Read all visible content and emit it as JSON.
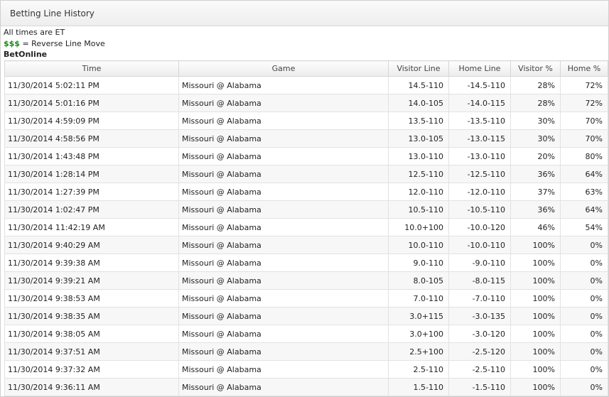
{
  "window": {
    "title": "Betting Line History"
  },
  "notes": {
    "times": "All times are ET",
    "money_symbol": "$$$",
    "money_desc": " = Reverse Line Move"
  },
  "book": "BetOnline",
  "columns": [
    "Time",
    "Game",
    "Visitor Line",
    "Home Line",
    "Visitor %",
    "Home %"
  ],
  "rows": [
    [
      "11/30/2014 5:02:11 PM",
      "Missouri @ Alabama",
      "14.5-110",
      "-14.5-110",
      "28%",
      "72%"
    ],
    [
      "11/30/2014 5:01:16 PM",
      "Missouri @ Alabama",
      "14.0-105",
      "-14.0-115",
      "28%",
      "72%"
    ],
    [
      "11/30/2014 4:59:09 PM",
      "Missouri @ Alabama",
      "13.5-110",
      "-13.5-110",
      "30%",
      "70%"
    ],
    [
      "11/30/2014 4:58:56 PM",
      "Missouri @ Alabama",
      "13.0-105",
      "-13.0-115",
      "30%",
      "70%"
    ],
    [
      "11/30/2014 1:43:48 PM",
      "Missouri @ Alabama",
      "13.0-110",
      "-13.0-110",
      "20%",
      "80%"
    ],
    [
      "11/30/2014 1:28:14 PM",
      "Missouri @ Alabama",
      "12.5-110",
      "-12.5-110",
      "36%",
      "64%"
    ],
    [
      "11/30/2014 1:27:39 PM",
      "Missouri @ Alabama",
      "12.0-110",
      "-12.0-110",
      "37%",
      "63%"
    ],
    [
      "11/30/2014 1:02:47 PM",
      "Missouri @ Alabama",
      "10.5-110",
      "-10.5-110",
      "36%",
      "64%"
    ],
    [
      "11/30/2014 11:42:19 AM",
      "Missouri @ Alabama",
      "10.0+100",
      "-10.0-120",
      "46%",
      "54%"
    ],
    [
      "11/30/2014 9:40:29 AM",
      "Missouri @ Alabama",
      "10.0-110",
      "-10.0-110",
      "100%",
      "0%"
    ],
    [
      "11/30/2014 9:39:38 AM",
      "Missouri @ Alabama",
      "9.0-110",
      "-9.0-110",
      "100%",
      "0%"
    ],
    [
      "11/30/2014 9:39:21 AM",
      "Missouri @ Alabama",
      "8.0-105",
      "-8.0-115",
      "100%",
      "0%"
    ],
    [
      "11/30/2014 9:38:53 AM",
      "Missouri @ Alabama",
      "7.0-110",
      "-7.0-110",
      "100%",
      "0%"
    ],
    [
      "11/30/2014 9:38:35 AM",
      "Missouri @ Alabama",
      "3.0+115",
      "-3.0-135",
      "100%",
      "0%"
    ],
    [
      "11/30/2014 9:38:05 AM",
      "Missouri @ Alabama",
      "3.0+100",
      "-3.0-120",
      "100%",
      "0%"
    ],
    [
      "11/30/2014 9:37:51 AM",
      "Missouri @ Alabama",
      "2.5+100",
      "-2.5-120",
      "100%",
      "0%"
    ],
    [
      "11/30/2014 9:37:32 AM",
      "Missouri @ Alabama",
      "2.5-110",
      "-2.5-110",
      "100%",
      "0%"
    ],
    [
      "11/30/2014 9:36:11 AM",
      "Missouri @ Alabama",
      "1.5-110",
      "-1.5-110",
      "100%",
      "0%"
    ]
  ]
}
